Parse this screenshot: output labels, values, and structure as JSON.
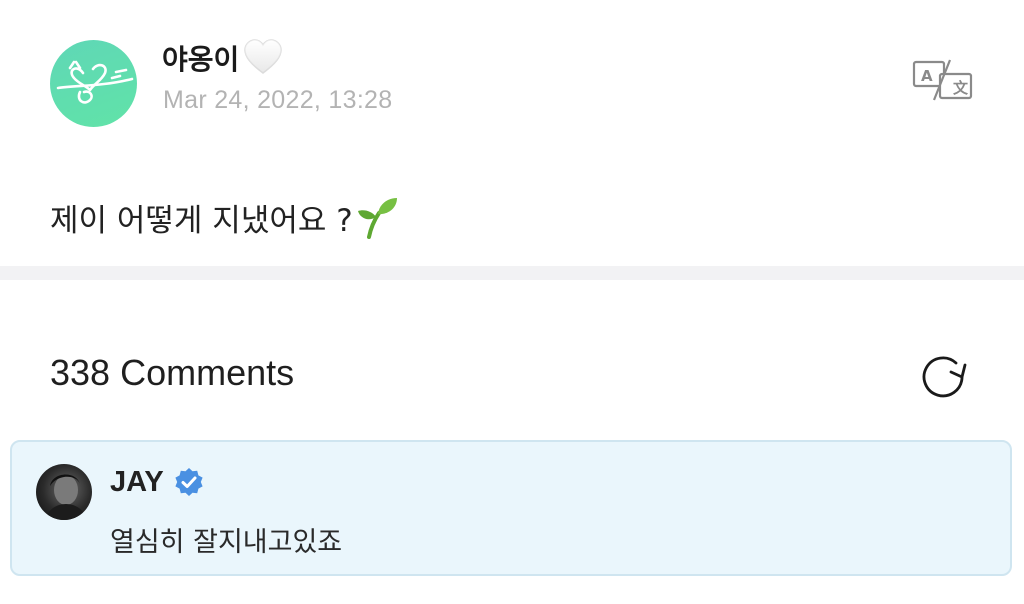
{
  "post": {
    "author_name": "야옹이",
    "author_emoji_icon": "white-heart-icon",
    "date": "Mar 24, 2022, 13:28",
    "body_text": "제이 어떻게 지냈어요 ?",
    "body_emoji_icon": "seedling-icon",
    "translate_icon": "translate-icon",
    "avatar_color": "#5fd7b6"
  },
  "comments": {
    "count_label": "338 Comments",
    "refresh_icon": "refresh-icon",
    "items": [
      {
        "author": "JAY",
        "verified": true,
        "verified_color": "#4a90e2",
        "text": "열심히 잘지내고있죠",
        "highlight_bg": "#eaf6fc"
      }
    ]
  }
}
